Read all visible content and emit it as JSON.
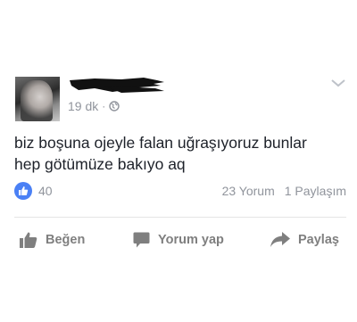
{
  "post": {
    "timestamp": "19 dk",
    "separator": "·",
    "text_line1": "biz boşuna ojeyle falan uğraşıyoruz bunlar",
    "text_line2": "hep götümüze bakıyo aq",
    "likes_count": "40",
    "comments_count": "23 Yorum",
    "shares_count": "1 Paylaşım"
  },
  "actions": {
    "like_label": "Beğen",
    "comment_label": "Yorum yap",
    "share_label": "Paylaş"
  },
  "icons": {
    "privacy": "globe-icon",
    "menu": "chevron-down-icon",
    "reaction": "thumbs-up-icon",
    "like": "thumbs-up-icon",
    "comment": "speech-bubble-icon",
    "share": "share-arrow-icon"
  },
  "colors": {
    "like_blue": "#4a80f5",
    "meta_gray": "#90949c",
    "action_gray": "#7f7f7f",
    "text": "#1d2129"
  }
}
